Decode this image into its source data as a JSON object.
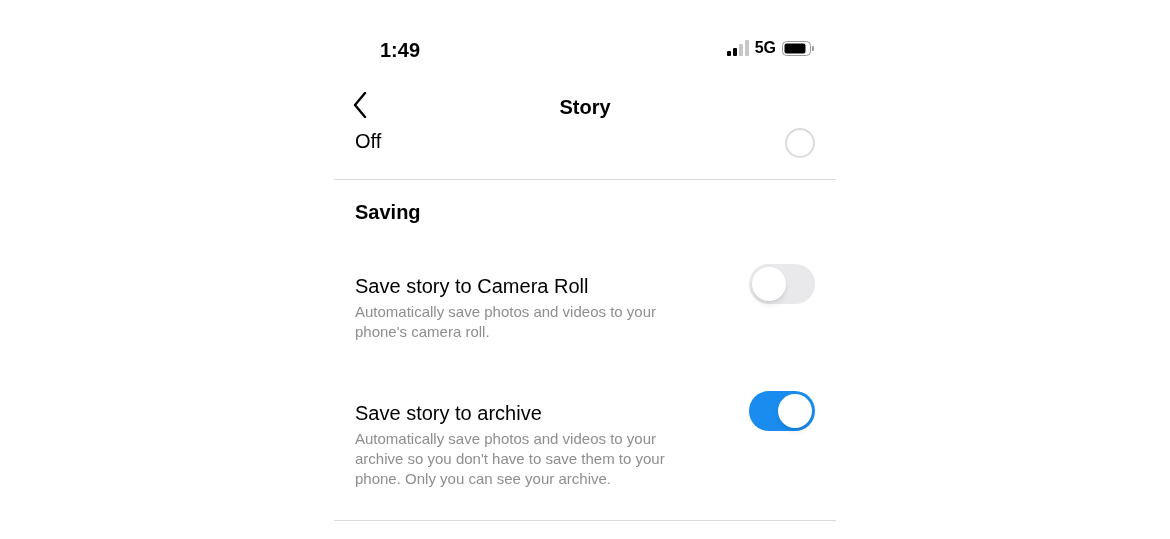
{
  "status_bar": {
    "time": "1:49",
    "network": "5G"
  },
  "header": {
    "title": "Story"
  },
  "top_option": {
    "label": "Off",
    "selected": false
  },
  "section": {
    "title": "Saving"
  },
  "settings": [
    {
      "title": "Save story to Camera Roll",
      "description": "Automatically save photos and videos to your phone's camera roll.",
      "on": false
    },
    {
      "title": "Save story to archive",
      "description": "Automatically save photos and videos to your archive so you don't have to save them to your phone. Only you can see your archive.",
      "on": true
    }
  ]
}
